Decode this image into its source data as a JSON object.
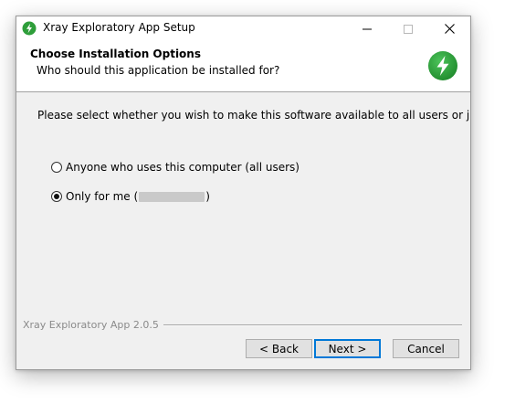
{
  "window": {
    "title": "Xray Exploratory App Setup"
  },
  "header": {
    "title": "Choose Installation Options",
    "subtitle": "Who should this application be installed for?"
  },
  "content": {
    "description": "Please select whether you wish to make this software available to all users or just yourself",
    "options": [
      {
        "label": "Anyone who uses this computer (all users)",
        "checked": false
      },
      {
        "label_prefix": "Only for me (",
        "label_suffix": ")",
        "checked": true
      }
    ]
  },
  "footer": {
    "brand": "Xray Exploratory App 2.0.5",
    "back_label": "< Back",
    "next_label": "Next >",
    "cancel_label": "Cancel"
  },
  "colors": {
    "logo_green": "#2e9e3a",
    "focus_blue": "#0078d7"
  },
  "icons": {
    "app": "lightning-icon",
    "minimize": "minimize-icon",
    "maximize": "maximize-icon",
    "close": "close-icon"
  }
}
